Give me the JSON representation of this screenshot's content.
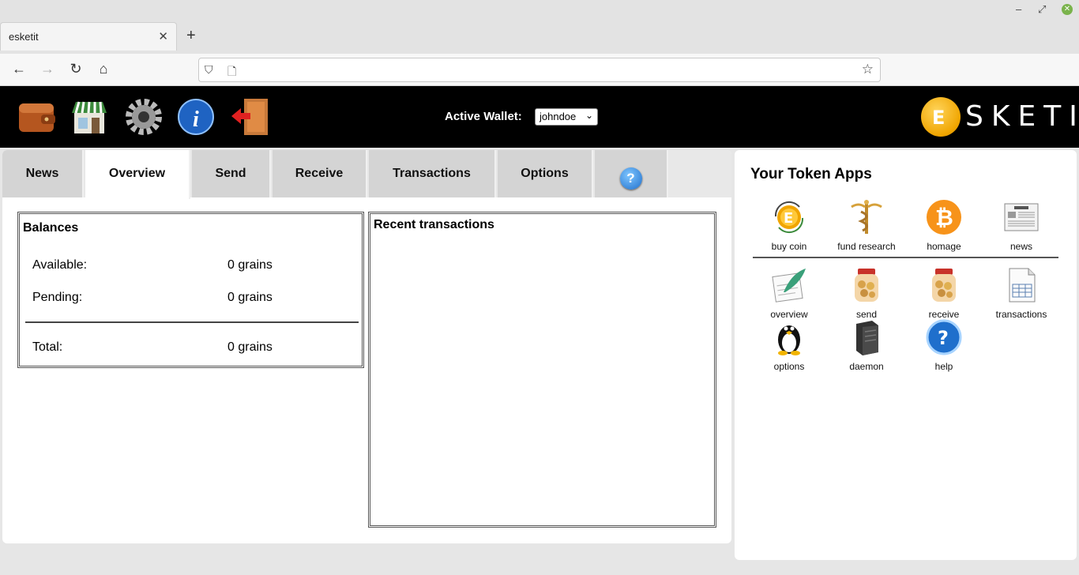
{
  "browser": {
    "tab_title": "esketit",
    "tab_close": "✕",
    "new_tab": "+",
    "minimize": "–",
    "maximize": "⤢",
    "close": "✕",
    "back": "←",
    "forward": "→",
    "reload": "↻",
    "home": "⌂",
    "shield": "⛉",
    "page": "🗋",
    "bookmark": "☆",
    "url": ""
  },
  "header": {
    "icons": [
      "wallet-icon",
      "shop-icon",
      "gear-icon",
      "info-icon",
      "logout-icon"
    ],
    "active_wallet_label": "Active Wallet:",
    "wallet_selected": "johndoe",
    "logo_letter": "E",
    "logo_text": "SKETIT"
  },
  "tabs": [
    {
      "label": "News"
    },
    {
      "label": "Overview",
      "active": true
    },
    {
      "label": "Send"
    },
    {
      "label": "Receive"
    },
    {
      "label": "Transactions"
    },
    {
      "label": "Options"
    },
    {
      "label": "?"
    }
  ],
  "balances": {
    "title": "Balances",
    "available_label": "Available:",
    "available_value": "0 grains",
    "pending_label": "Pending:",
    "pending_value": "0 grains",
    "total_label": "Total:",
    "total_value": "0 grains"
  },
  "recent": {
    "title": "Recent transactions"
  },
  "token_apps": {
    "title": "Your Token Apps",
    "top_row": [
      {
        "label": "buy coin",
        "icon": "coin-refresh-icon"
      },
      {
        "label": "fund research",
        "icon": "caduceus-icon"
      },
      {
        "label": "homage",
        "icon": "bitcoin-icon"
      },
      {
        "label": "news",
        "icon": "newspaper-icon"
      }
    ],
    "bottom": [
      {
        "label": "overview",
        "icon": "notepad-feather-icon"
      },
      {
        "label": "send",
        "icon": "coin-jar-icon"
      },
      {
        "label": "receive",
        "icon": "coin-jar-icon"
      },
      {
        "label": "transactions",
        "icon": "document-table-icon"
      },
      {
        "label": "options",
        "icon": "penguin-icon"
      },
      {
        "label": "daemon",
        "icon": "server-icon"
      },
      {
        "label": "help",
        "icon": "help-icon"
      }
    ],
    "bitcoin_symbol": "₿",
    "help_symbol": "?",
    "coin_letter": "E"
  },
  "colors": {
    "header_bg": "#000000",
    "accent_gold": "#f0a500",
    "help_blue": "#1f6fcc"
  }
}
